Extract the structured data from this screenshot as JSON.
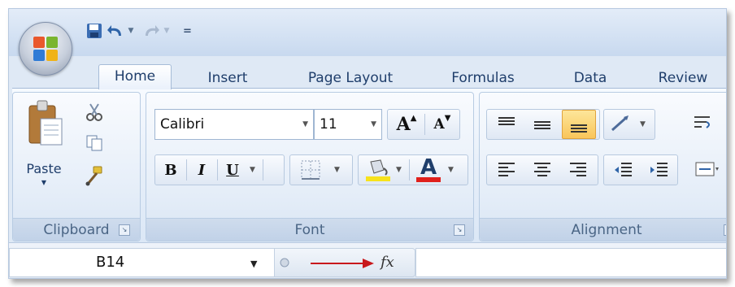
{
  "quick_access": {
    "save_icon": "save-icon",
    "undo_icon": "undo-icon",
    "redo_icon": "redo-icon",
    "customize_glyph": "="
  },
  "tabs": [
    {
      "label": "Home"
    },
    {
      "label": "Insert"
    },
    {
      "label": "Page Layout"
    },
    {
      "label": "Formulas"
    },
    {
      "label": "Data"
    },
    {
      "label": "Review"
    }
  ],
  "clipboard": {
    "paste_label": "Paste",
    "group_label": "Clipboard"
  },
  "font": {
    "font_name": "Calibri",
    "font_size": "11",
    "grow_label": "A",
    "shrink_label": "A",
    "bold_label": "B",
    "italic_label": "I",
    "underline_label": "U",
    "font_color_label": "A",
    "group_label": "Font",
    "highlight_color": "#f7e21c",
    "font_color": "#e0201c"
  },
  "alignment": {
    "group_label": "Alignment"
  },
  "formula_bar": {
    "name_box": "B14",
    "fx_label": "fx"
  }
}
